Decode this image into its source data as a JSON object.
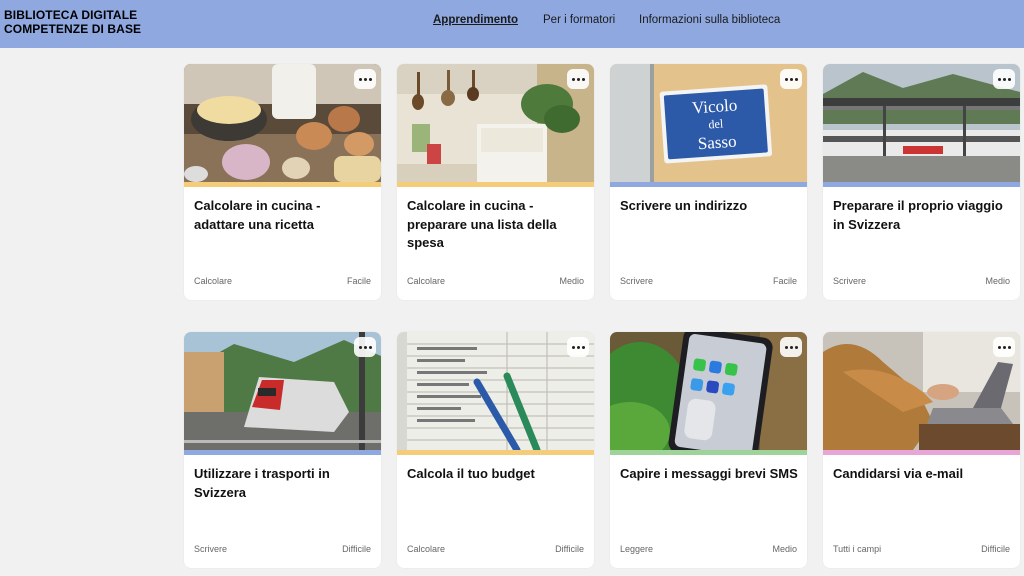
{
  "brand": {
    "line1": "BIBLIOTECA DIGITALE",
    "line2": "COMPETENZE DI BASE"
  },
  "nav": [
    {
      "label": "Apprendimento",
      "active": true
    },
    {
      "label": "Per i formatori",
      "active": false
    },
    {
      "label": "Informazioni sulla biblioteca",
      "active": false
    }
  ],
  "cards": [
    {
      "title": "Calcolare in cucina - adattare una ricetta",
      "tag": "Calcolare",
      "level": "Facile",
      "accent": "#f5cd7a",
      "image": "ingredients-photo"
    },
    {
      "title": "Calcolare in cucina - preparare una lista della spesa",
      "tag": "Calcolare",
      "level": "Medio",
      "accent": "#f5cd7a",
      "image": "kitchen-photo"
    },
    {
      "title": "Scrivere un indirizzo",
      "tag": "Scrivere",
      "level": "Facile",
      "accent": "#8fa8e0",
      "image": "street-sign-photo",
      "sign": [
        "Vicolo",
        "del",
        "Sasso"
      ]
    },
    {
      "title": "Preparare il proprio viaggio in Svizzera",
      "tag": "Scrivere",
      "level": "Medio",
      "accent": "#8fa8e0",
      "image": "train-station-photo"
    },
    {
      "title": "Utilizzare i trasporti in Svizzera",
      "tag": "Scrivere",
      "level": "Difficile",
      "accent": "#8fa8e0",
      "image": "train-photo"
    },
    {
      "title": "Calcola il tuo budget",
      "tag": "Calcolare",
      "level": "Difficile",
      "accent": "#f5cd7a",
      "image": "budget-sheet-photo"
    },
    {
      "title": "Capire i messaggi brevi SMS",
      "tag": "Leggere",
      "level": "Medio",
      "accent": "#9ed39a",
      "image": "smartphone-photo"
    },
    {
      "title": "Candidarsi via e-mail",
      "tag": "Tutti i campi",
      "level": "Difficile",
      "accent": "#e7a6d6",
      "image": "laptop-photo"
    }
  ]
}
